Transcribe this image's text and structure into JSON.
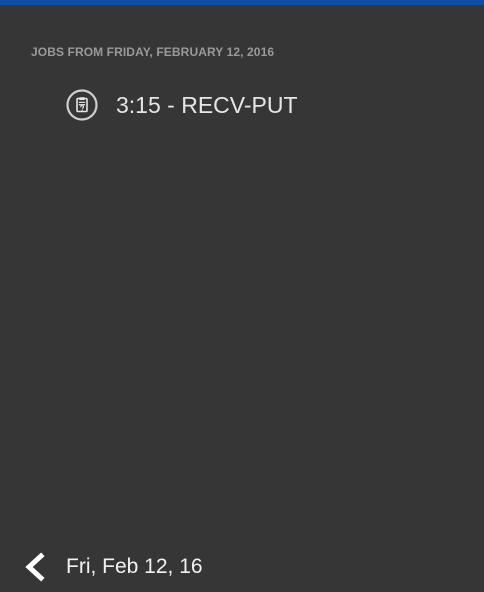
{
  "colors": {
    "background": "#363636",
    "top_accent": "#0b4ea2",
    "header_text": "#9a9a9a",
    "job_text": "#e6e6e6",
    "footer_text": "#f2f2f2"
  },
  "section_header": "JOBS FROM FRIDAY, FEBRUARY 12, 2016",
  "jobs": [
    {
      "icon": "clipboard-icon",
      "label": "3:15 - RECV-PUT"
    }
  ],
  "footer": {
    "back_icon": "chevron-left-icon",
    "date_label": "Fri, Feb 12, 16"
  }
}
